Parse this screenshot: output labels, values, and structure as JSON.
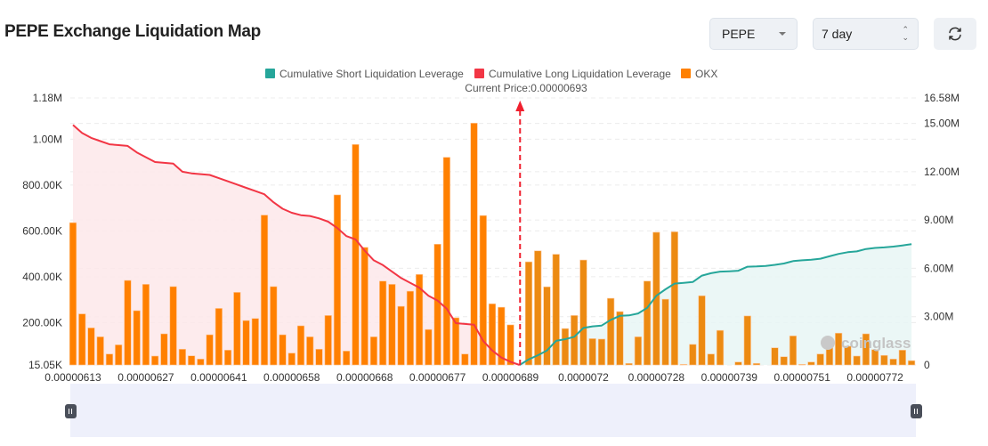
{
  "header": {
    "title": "PEPE Exchange Liquidation Map",
    "symbol_select": "PEPE",
    "range_select": "7 day",
    "refresh_icon": "refresh-icon"
  },
  "colors": {
    "short": "#26a69a",
    "long": "#f23645",
    "okx": "#ff8000",
    "short_fill": "#e8f6f4",
    "long_fill": "#fde8ea",
    "slider_bg": "#eef0fb"
  },
  "watermark": "coinglass",
  "chart_data": {
    "type": "bar",
    "legend_position": "top",
    "grid": true,
    "legend": [
      "Cumulative Short Liquidation Leverage",
      "Cumulative Long Liquidation Leverage",
      "OKX"
    ],
    "current_price_label": "Current Price:0.00000693",
    "current_price_index": 49,
    "x_ticks": [
      {
        "index": 0,
        "label": "0.00000613"
      },
      {
        "index": 8,
        "label": "0.00000627"
      },
      {
        "index": 16,
        "label": "0.00000641"
      },
      {
        "index": 24,
        "label": "0.00000658"
      },
      {
        "index": 32,
        "label": "0.00000668"
      },
      {
        "index": 40,
        "label": "0.00000677"
      },
      {
        "index": 48,
        "label": "0.00000689"
      },
      {
        "index": 56,
        "label": "0.0000072"
      },
      {
        "index": 64,
        "label": "0.00000728"
      },
      {
        "index": 72,
        "label": "0.00000739"
      },
      {
        "index": 80,
        "label": "0.00000751"
      },
      {
        "index": 88,
        "label": "0.00000772"
      }
    ],
    "y_left": {
      "ylim": [
        15050,
        1180000
      ],
      "tick_labels": [
        "1.18M",
        "1.00M",
        "800.00K",
        "600.00K",
        "400.00K",
        "200.00K",
        "15.05K"
      ],
      "tick_values": [
        1180000,
        1000000,
        800000,
        600000,
        400000,
        200000,
        15050
      ]
    },
    "y_right": {
      "ylim": [
        0,
        16580000
      ],
      "tick_labels": [
        "16.58M",
        "15.00M",
        "12.00M",
        "9.00M",
        "6.00M",
        "3.00M",
        "0"
      ],
      "tick_values": [
        16580000,
        15000000,
        12000000,
        9000000,
        6000000,
        3000000,
        0
      ]
    },
    "series": [
      {
        "name": "OKX",
        "type": "bar",
        "axis": "left",
        "values": [
          636000,
          238000,
          177000,
          138000,
          63000,
          103000,
          384000,
          252000,
          367000,
          54000,
          151000,
          357000,
          84000,
          55000,
          41000,
          147000,
          262000,
          80000,
          332000,
          209000,
          218000,
          669000,
          357000,
          147000,
          67000,
          186000,
          138000,
          84000,
          231000,
          757000,
          76000,
          977000,
          528000,
          138000,
          381000,
          367000,
          271000,
          337000,
          410000,
          170000,
          542000,
          921000,
          221000,
          63000,
          1070000,
          667000,
          282000,
          267000,
          190000,
          0,
          465000,
          513000,
          356000,
          498000,
          174000,
          231000,
          473000,
          130000,
          128000,
          306000,
          248000,
          22000,
          138000,
          381000,
          594000,
          302000,
          596000,
          18000,
          105000,
          317000,
          63000,
          166000,
          15000,
          28000,
          229000,
          22000,
          15000,
          90000,
          51000,
          142000,
          18000,
          28000,
          63000,
          103000,
          154000,
          97000,
          54000,
          151000,
          82000,
          57000,
          41000,
          80000,
          34000
        ]
      },
      {
        "name": "Cumulative Long Liquidation Leverage",
        "type": "line",
        "axis": "right",
        "start_index": 0,
        "values": [
          14900000,
          14400000,
          14100000,
          13900000,
          13700000,
          13650000,
          13600000,
          13200000,
          12900000,
          12600000,
          12550000,
          12500000,
          12000000,
          11900000,
          11850000,
          11800000,
          11600000,
          11400000,
          11200000,
          11000000,
          10800000,
          10600000,
          10100000,
          9700000,
          9450000,
          9300000,
          9250000,
          9100000,
          8900000,
          8500000,
          8000000,
          7800000,
          7100000,
          6500000,
          6200000,
          5800000,
          5400000,
          5100000,
          4800000,
          4300000,
          4000000,
          3500000,
          2600000,
          2550000,
          2500000,
          1500000,
          900000,
          460000,
          200000,
          0
        ]
      },
      {
        "name": "Cumulative Short Liquidation Leverage",
        "type": "line",
        "axis": "right",
        "start_index": 49,
        "values": [
          0,
          350000,
          600000,
          900000,
          1500000,
          1600000,
          1750000,
          2300000,
          2400000,
          2450000,
          2800000,
          3050000,
          3080000,
          3200000,
          3550000,
          4300000,
          4700000,
          5050000,
          5100000,
          5150000,
          5550000,
          5700000,
          5800000,
          5820000,
          5850000,
          6100000,
          6120000,
          6150000,
          6220000,
          6300000,
          6450000,
          6500000,
          6530000,
          6600000,
          6750000,
          6900000,
          7000000,
          7050000,
          7200000,
          7270000,
          7300000,
          7350000,
          7420000,
          7500000
        ]
      }
    ]
  }
}
